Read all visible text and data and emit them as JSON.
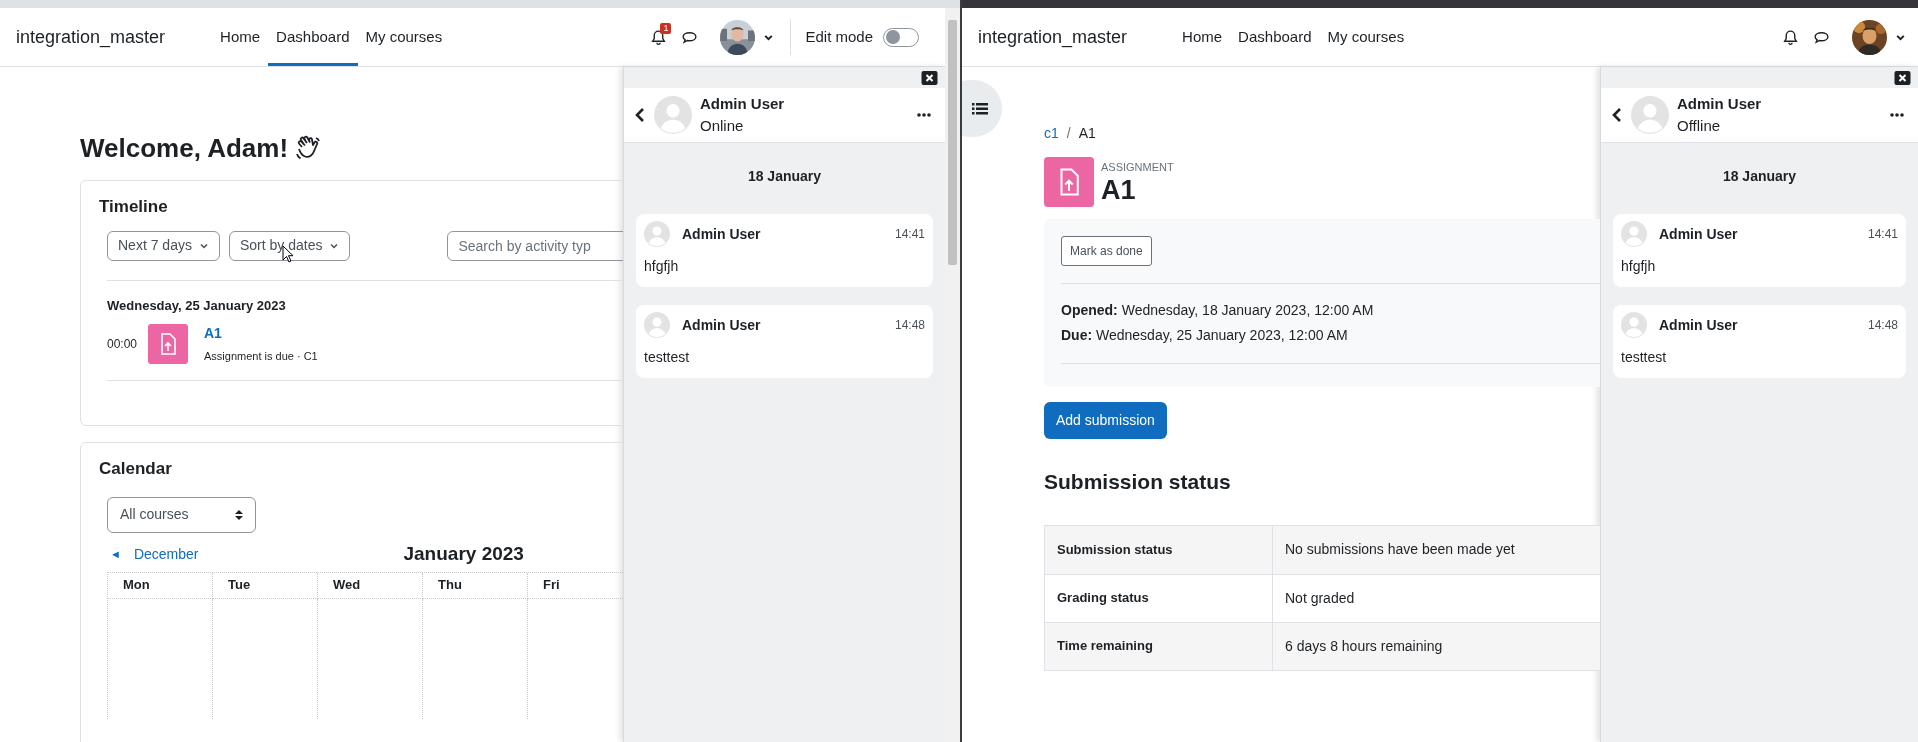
{
  "windows": [
    {
      "navbar": {
        "site_name": "integration_master",
        "nav_links": [
          {
            "label": "Home",
            "selected": false
          },
          {
            "label": "Dashboard",
            "selected": true
          },
          {
            "label": "My courses",
            "selected": false
          }
        ],
        "notification_count": "1",
        "edit_mode": {
          "label": "Edit mode",
          "on": false
        }
      },
      "page": {
        "kind": "dashboard",
        "greeting": "Welcome, Adam!",
        "timeline": {
          "title": "Timeline",
          "filters": [
            "Next 7 days",
            "Sort by dates"
          ],
          "search_placeholder": "Search by activity typ",
          "date_heading": "Wednesday, 25 January 2023",
          "events": [
            {
              "time": "00:00",
              "name": "A1",
              "detail": "Assignment is due · C1"
            }
          ]
        },
        "calendar": {
          "title": "Calendar",
          "course_filter": "All courses",
          "prev_arrow": "◄",
          "prev_month": "December",
          "month": "January 2023",
          "weekdays": [
            "Mon",
            "Tue",
            "Wed",
            "Thu",
            "Fri"
          ]
        }
      },
      "drawer": {
        "contact": "Admin User",
        "presence": "Online",
        "date": "18 January",
        "messages": [
          {
            "sender": "Admin User",
            "time": "14:41",
            "text": "hfgfjh"
          },
          {
            "sender": "Admin User",
            "time": "14:48",
            "text": "testtest"
          }
        ]
      }
    },
    {
      "navbar": {
        "site_name": "integration_master",
        "nav_links": [
          {
            "label": "Home",
            "selected": false
          },
          {
            "label": "Dashboard",
            "selected": false
          },
          {
            "label": "My courses",
            "selected": false
          }
        ]
      },
      "page": {
        "kind": "assignment",
        "breadcrumb_separator": "/",
        "breadcrumb": [
          {
            "label": "c1",
            "link": true
          },
          {
            "label": "A1",
            "link": false
          }
        ],
        "activity_type": "ASSIGNMENT",
        "title": "A1",
        "mark_done": "Mark as done",
        "dates": [
          "**Opened:** Wednesday, 18 January 2023, 12:00 AM",
          "**Due:** Wednesday, 25 January 2023, 12:00 AM"
        ],
        "add_submission": "Add submission",
        "status_heading": "Submission status",
        "status_rows": [
          {
            "label": "Submission status",
            "value": "No submissions have been made yet"
          },
          {
            "label": "Grading status",
            "value": "Not graded"
          },
          {
            "label": "Time remaining",
            "value": "6 days 8 hours remaining"
          }
        ]
      },
      "drawer": {
        "contact": "Admin User",
        "presence": "Offline",
        "date": "18 January",
        "messages": [
          {
            "sender": "Admin User",
            "time": "14:41",
            "text": "hfgfjh"
          },
          {
            "sender": "Admin User",
            "time": "14:48",
            "text": "testtest"
          }
        ]
      }
    }
  ]
}
